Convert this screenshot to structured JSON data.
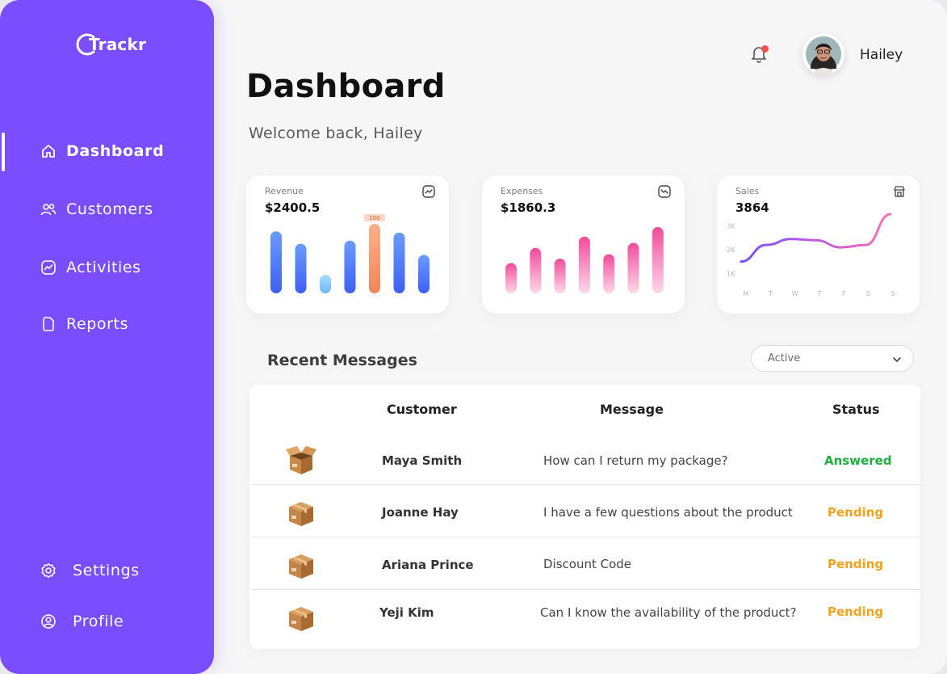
{
  "app": {
    "logo_text": "Trackr"
  },
  "sidebar": {
    "items": [
      {
        "label": "Dashboard",
        "icon": "home-icon",
        "active": true
      },
      {
        "label": "Customers",
        "icon": "users-icon"
      },
      {
        "label": "Activities",
        "icon": "activity-icon"
      },
      {
        "label": "Reports",
        "icon": "document-icon"
      }
    ],
    "bottom_items": [
      {
        "label": "Settings",
        "icon": "gear-icon"
      },
      {
        "label": "Profile",
        "icon": "user-circle-icon"
      }
    ]
  },
  "header": {
    "user_name": "Hailey",
    "notification_icon": "bell-icon",
    "has_notification": true
  },
  "page": {
    "title": "Dashboard",
    "welcome": "Welcome back, Hailey"
  },
  "cards": [
    {
      "label": "Revenue",
      "value": "$2400.5",
      "icon": "trend-up-icon"
    },
    {
      "label": "Expenses",
      "value": "$1860.3",
      "icon": "trend-down-icon"
    },
    {
      "label": "Sales",
      "value": "3864",
      "icon": "store-icon"
    }
  ],
  "chart_data": [
    {
      "type": "bar",
      "title": "Revenue",
      "values": [
        100,
        80,
        30,
        85,
        112,
        98,
        62
      ],
      "highlight_index": 4,
      "highlight_label": "100",
      "colors": {
        "bar": "#3f5ff0",
        "highlight": "#f0845a"
      }
    },
    {
      "type": "bar",
      "title": "Expenses",
      "values": [
        48,
        72,
        55,
        90,
        62,
        80,
        105
      ],
      "colors": {
        "bar": "#f04b9a"
      }
    },
    {
      "type": "line",
      "title": "Sales",
      "x": [
        "M",
        "T",
        "W",
        "T",
        "F",
        "S",
        "S"
      ],
      "y_ticks": [
        "1K",
        "2K",
        "3K"
      ],
      "ylim": [
        0.5,
        3.5
      ],
      "values": [
        1.5,
        2.2,
        2.45,
        2.4,
        2.1,
        2.2,
        3.5
      ],
      "colors": {
        "start": "#7b4dff",
        "end": "#ff6fb8"
      }
    }
  ],
  "messages": {
    "title": "Recent Messages",
    "filter": "Active",
    "columns": [
      "Customer",
      "Message",
      "Status"
    ],
    "rows": [
      {
        "customer": "Maya Smith",
        "message": "How can I return my package?",
        "status": "Answered",
        "icon": "open-box-icon"
      },
      {
        "customer": "Joanne Hay",
        "message": "I have a few questions about the product",
        "status": "Pending",
        "icon": "box-icon"
      },
      {
        "customer": "Ariana Prince",
        "message": "Discount Code",
        "status": "Pending",
        "icon": "box-icon"
      },
      {
        "customer": "Yeji Kim",
        "message": "Can I know the availability of the product?",
        "status": "Pending",
        "icon": "box-icon"
      }
    ],
    "status_colors": {
      "Answered": "#1fae3f",
      "Pending": "#f2a21b"
    }
  }
}
